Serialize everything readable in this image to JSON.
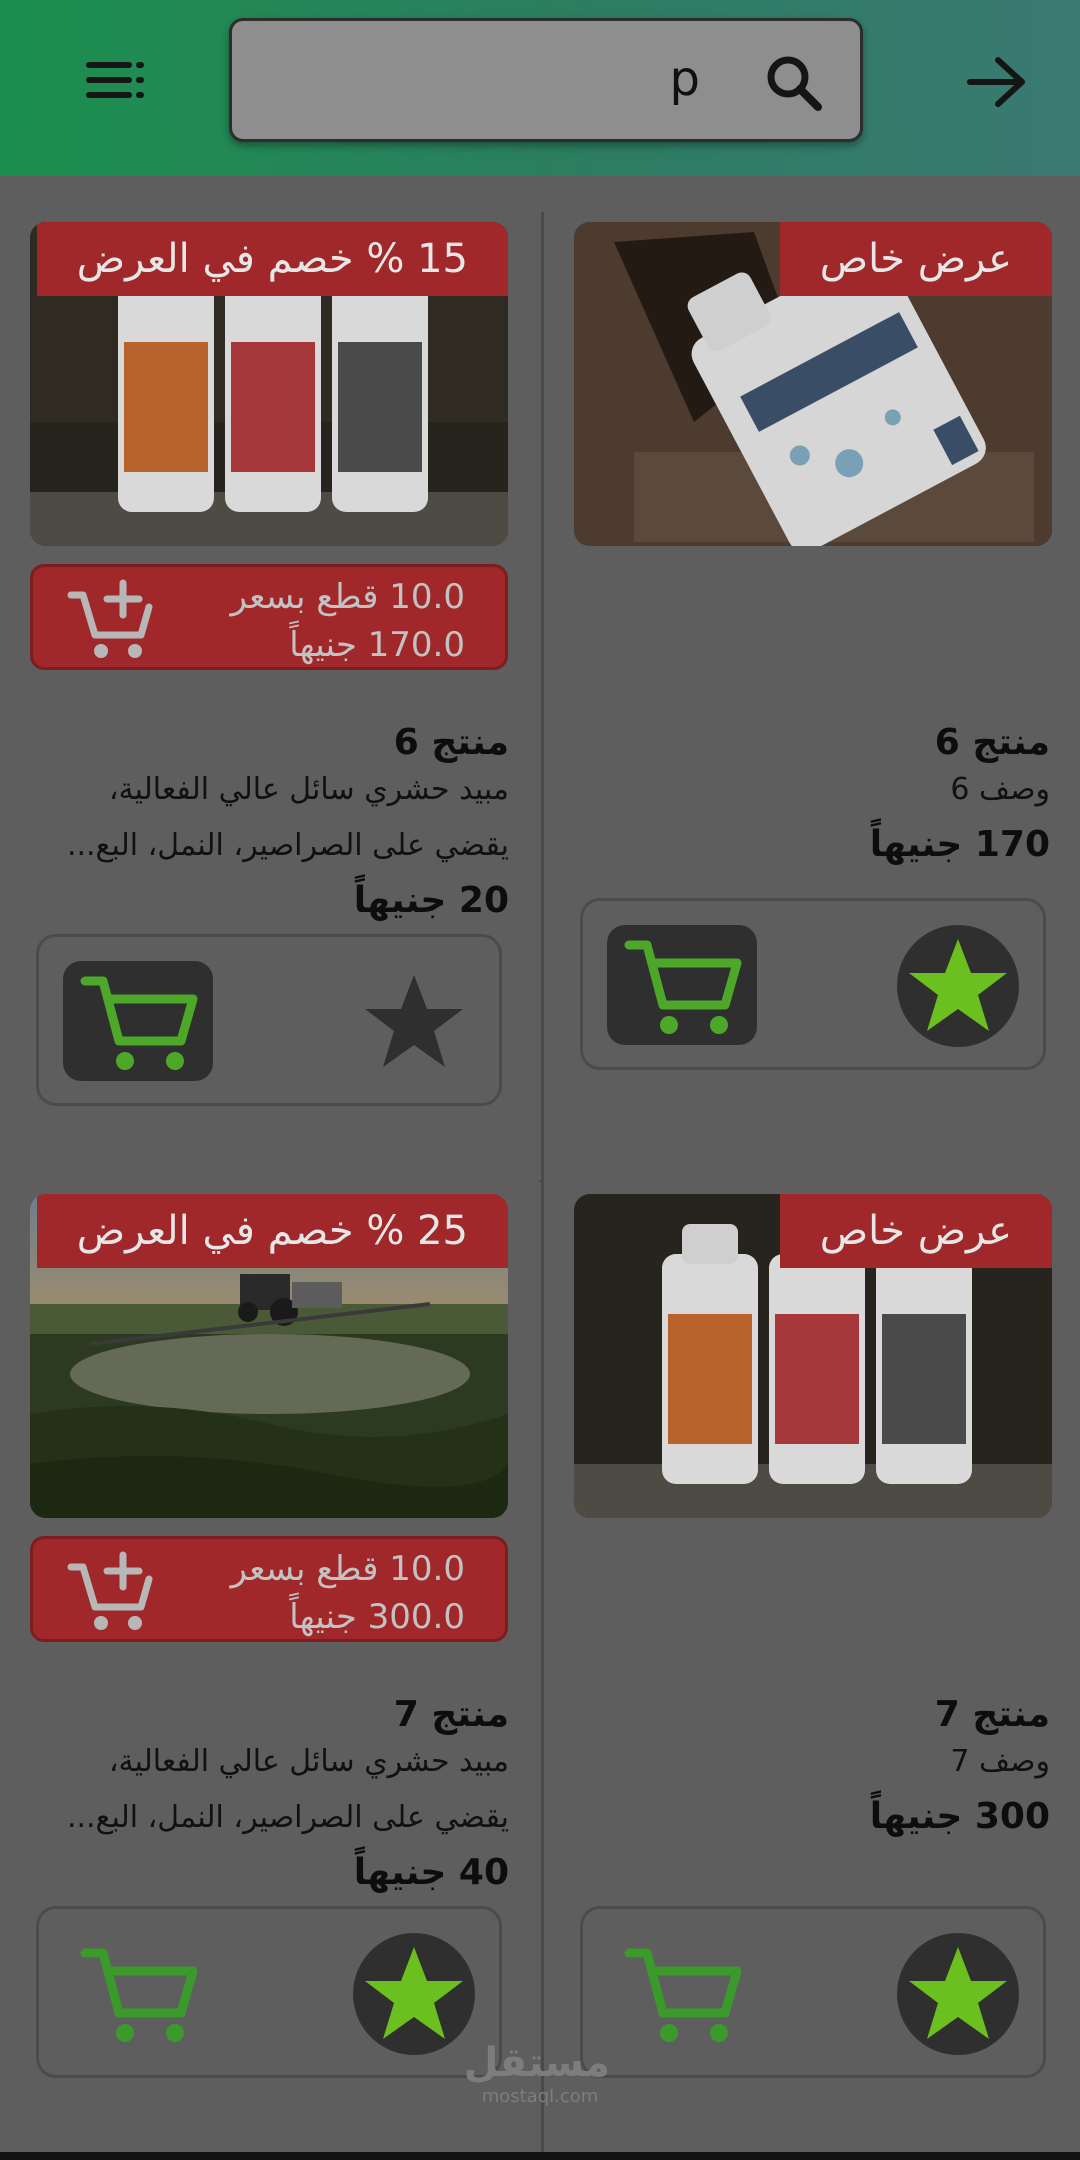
{
  "search": {
    "value": "p"
  },
  "icons": {
    "menu": "menu-icon",
    "search": "search-icon",
    "back": "arrow-right-icon",
    "cart": "cart-icon",
    "add_cart": "cart-plus-icon",
    "star": "star-icon"
  },
  "colors": {
    "appbar_start": "#1c8f4e",
    "appbar_end": "#3a7a73",
    "badge": "#a0282a",
    "cart_green": "#3a9a2a",
    "star_green": "#6bbf1f"
  },
  "products": [
    {
      "badge": "عرض خاص",
      "name": "منتج 6",
      "description_lines": [
        "وصف 6"
      ],
      "price": "170 جنيهاً",
      "favorite": true,
      "cart_style": "filled"
    },
    {
      "badge": "15 % خصم في العرض",
      "offer_qty": "10.0 قطع بسعر",
      "offer_price": "170.0 جنيهاً",
      "name": "منتج 6",
      "description_lines": [
        "مبيد حشري سائل عالي الفعالية،",
        "يقضي على الصراصير، النمل، البع..."
      ],
      "price": "20 جنيهاً",
      "favorite": false,
      "cart_style": "filled"
    },
    {
      "badge": "عرض خاص",
      "name": "منتج 7",
      "description_lines": [
        "وصف 7"
      ],
      "price": "300 جنيهاً",
      "favorite": true,
      "cart_style": "plain"
    },
    {
      "badge": "25 % خصم في العرض",
      "offer_qty": "10.0 قطع بسعر",
      "offer_price": "300.0 جنيهاً",
      "name": "منتج 7",
      "description_lines": [
        "مبيد حشري سائل عالي الفعالية،",
        "يقضي على الصراصير، النمل، البع..."
      ],
      "price": "40 جنيهاً",
      "favorite": true,
      "cart_style": "plain"
    }
  ],
  "watermark": {
    "arabic": "مستقل",
    "latin": "mostaql.com"
  }
}
